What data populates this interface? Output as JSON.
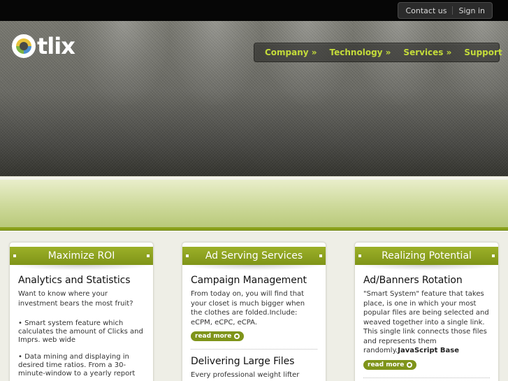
{
  "topbar": {
    "contact_label": "Contact us",
    "signin_label": "Sign in"
  },
  "logo": {
    "text": "tlix"
  },
  "nav": {
    "items": [
      "Company »",
      "Technology »",
      "Services »",
      "Support"
    ]
  },
  "colors": {
    "accent_green": "#7f941a",
    "nav_text": "#c4dc3a",
    "topbar_bg": "#060606"
  },
  "cards": [
    {
      "header": "Maximize ROI",
      "title": "Analytics and Statistics",
      "text": "Want to know where your investment bears the most fruit?",
      "bullets": [
        "Smart system feature which calculates the amount of Clicks and Imprs. web wide",
        "Data mining and displaying in desired time ratios. From a 30-minute-window to a yearly report"
      ]
    },
    {
      "header": "Ad Serving Services",
      "title": "Campaign Management",
      "text": "From today on, you will find that your closet is much bigger when the clothes are folded.Include: eCPM, eCPC, eCPA.",
      "read_more": "read more",
      "title2": "Delivering Large Files",
      "text2": "Every professional weight lifter should"
    },
    {
      "header": "Realizing Potential",
      "title": "Ad/Banners Rotation",
      "text": "\"Smart System\" feature that takes place, is one in which your most popular files are being selected and weaved together into a single link. This single link connects those files and represents them randomly.",
      "text_bold": "JavaScript Base",
      "read_more": "read more"
    }
  ]
}
